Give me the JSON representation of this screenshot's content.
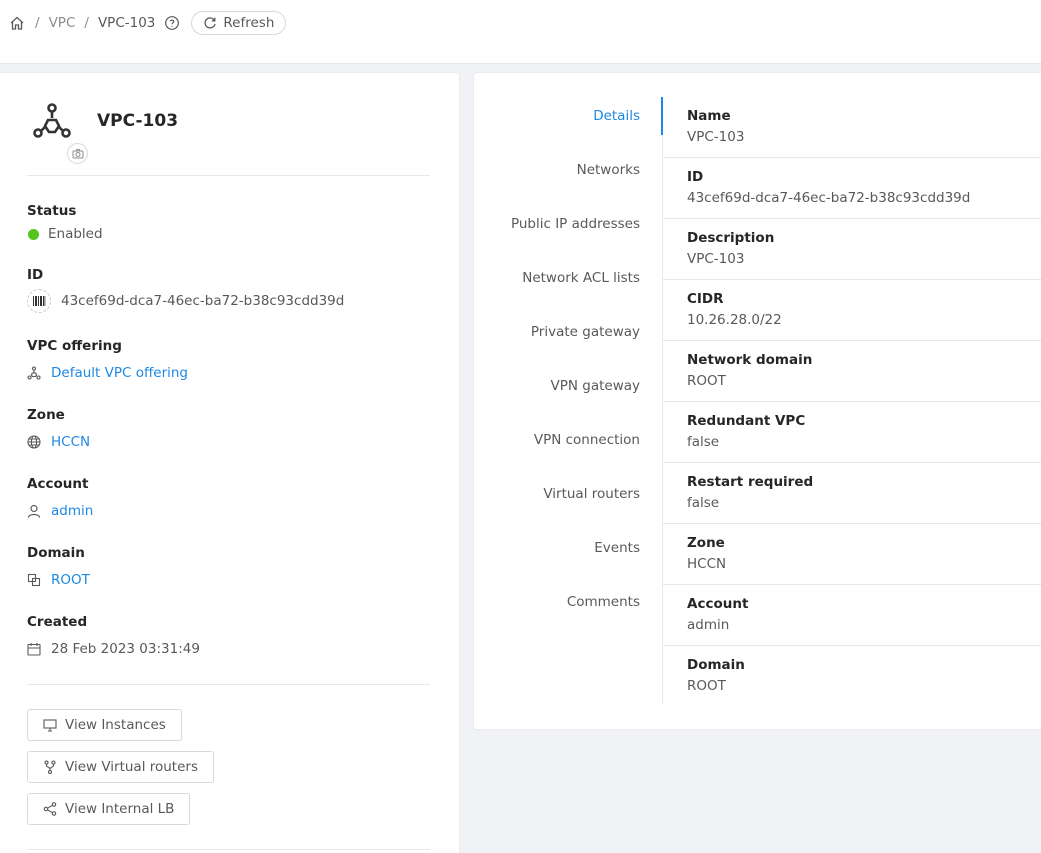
{
  "breadcrumb": {
    "items": [
      "VPC",
      "VPC-103"
    ],
    "separator": "/",
    "refresh_label": "Refresh"
  },
  "resource": {
    "name": "VPC-103",
    "icon": "vpc-network-icon"
  },
  "left_fields": {
    "status": {
      "label": "Status",
      "value": "Enabled",
      "color": "#52c41a"
    },
    "id": {
      "label": "ID",
      "value": "43cef69d-dca7-46ec-ba72-b38c93cdd39d"
    },
    "vpc_offering": {
      "label": "VPC offering",
      "value": "Default VPC offering"
    },
    "zone": {
      "label": "Zone",
      "value": "HCCN"
    },
    "account": {
      "label": "Account",
      "value": "admin"
    },
    "domain": {
      "label": "Domain",
      "value": "ROOT"
    },
    "created": {
      "label": "Created",
      "value": "28 Feb 2023 03:31:49"
    }
  },
  "actions": {
    "view_instances": "View Instances",
    "view_virtual_routers": "View Virtual routers",
    "view_internal_lb": "View Internal LB"
  },
  "tabs": [
    {
      "label": "Details",
      "active": true
    },
    {
      "label": "Networks"
    },
    {
      "label": "Public IP addresses"
    },
    {
      "label": "Network ACL lists"
    },
    {
      "label": "Private gateway"
    },
    {
      "label": "VPN gateway"
    },
    {
      "label": "VPN connection"
    },
    {
      "label": "Virtual routers"
    },
    {
      "label": "Events"
    },
    {
      "label": "Comments"
    }
  ],
  "details": [
    {
      "label": "Name",
      "value": "VPC-103"
    },
    {
      "label": "ID",
      "value": "43cef69d-dca7-46ec-ba72-b38c93cdd39d"
    },
    {
      "label": "Description",
      "value": "VPC-103"
    },
    {
      "label": "CIDR",
      "value": "10.26.28.0/22"
    },
    {
      "label": "Network domain",
      "value": "ROOT"
    },
    {
      "label": "Redundant VPC",
      "value": "false"
    },
    {
      "label": "Restart required",
      "value": "false"
    },
    {
      "label": "Zone",
      "value": "HCCN"
    },
    {
      "label": "Account",
      "value": "admin"
    },
    {
      "label": "Domain",
      "value": "ROOT"
    }
  ],
  "colors": {
    "accent": "#1e88e5",
    "enabled": "#52c41a"
  }
}
